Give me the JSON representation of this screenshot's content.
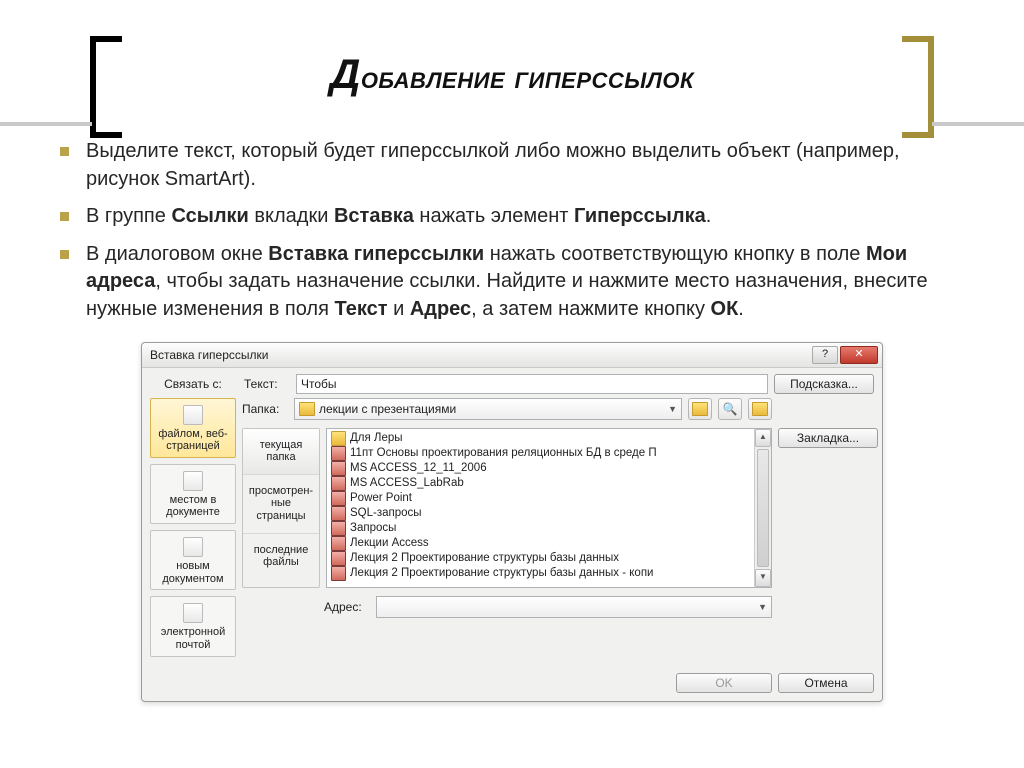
{
  "slide": {
    "title_cap": "Д",
    "title_rest": "обавление гиперссылок",
    "bullets": [
      "Выделите текст, который будет гиперссылкой либо можно выделить объект (например, рисунок SmartArt).",
      "В группе <b>Ссылки</b> вкладки <b>Вставка</b> нажать элемент <b>Гиперссылка</b>.",
      "В диалоговом окне <b>Вставка гиперссылки</b> нажать соответствующую кнопку в поле <b>Мои адреса</b>, чтобы задать назначение ссылки. Найдите и нажмите место назначения, внесите нужные изменения в поля <b>Текст</b> и <b>Адрес</b>, а затем нажмите кнопку <b>ОК</b>."
    ]
  },
  "dialog": {
    "title": "Вставка гиперссылки",
    "help_glyph": "?",
    "close_glyph": "✕",
    "link_to_label": "Связать с:",
    "text_label": "Текст:",
    "text_value": "Чтобы",
    "tooltip_btn": "Подсказка...",
    "folder_label": "Папка:",
    "folder_value": "лекции с презентациями",
    "bookmark_btn": "Закладка...",
    "linkto_items": [
      "файлом, веб-страницей",
      "местом в документе",
      "новым документом",
      "электронной почтой"
    ],
    "tabs": [
      "текущая папка",
      "просмотрен-\nные страницы",
      "последние файлы"
    ],
    "files": [
      {
        "name": "Для Леры",
        "type": "folder"
      },
      {
        "name": "11пт Основы проектирования реляционных БД в среде П",
        "type": "doc"
      },
      {
        "name": "MS ACCESS_12_11_2006",
        "type": "doc"
      },
      {
        "name": "MS ACCESS_LabRab",
        "type": "doc"
      },
      {
        "name": "Power Point",
        "type": "doc"
      },
      {
        "name": "SQL-запросы",
        "type": "doc"
      },
      {
        "name": "Запросы",
        "type": "doc"
      },
      {
        "name": "Лекции Access",
        "type": "doc"
      },
      {
        "name": "Лекция 2 Проектирование структуры базы данных",
        "type": "doc"
      },
      {
        "name": "Лекция 2 Проектирование структуры базы данных - копи",
        "type": "doc"
      }
    ],
    "address_label": "Адрес:",
    "address_value": "",
    "ok_btn": "OK",
    "cancel_btn": "Отмена"
  }
}
